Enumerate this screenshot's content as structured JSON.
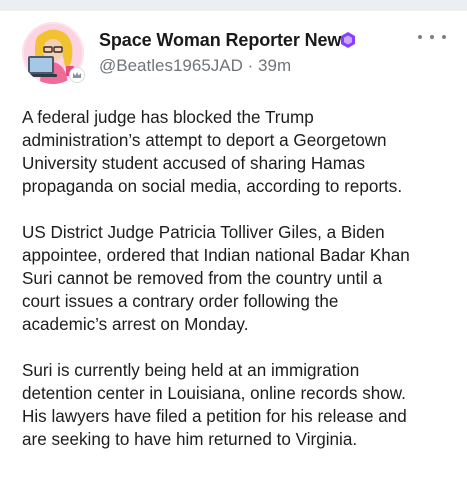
{
  "post": {
    "author": {
      "name": "Space Woman Reporter News",
      "handle": "@Beatles1965JAD",
      "separator": "·",
      "time": "39m",
      "avatar": "avatar-illustration-woman-with-laptop",
      "verified_icon": "hexagon-badge-icon",
      "avatar_badge_icon": "crown-icon"
    },
    "more_icon": "more-horizontal-icon",
    "paragraphs": [
      {
        "lines": [
          "A federal judge has blocked the Trump",
          "administration’s attempt to deport a Georgetown",
          "University student accused of sharing Hamas",
          "propaganda on social media, according to reports."
        ]
      },
      {
        "lines": [
          "US District Judge Patricia Tolliver Giles, a Biden",
          "appointee, ordered that Indian national Badar Khan",
          "Suri cannot be removed from the country until a",
          "court issues a contrary order following the",
          "academic’s arrest on Monday."
        ]
      },
      {
        "lines": [
          "Suri is currently being held at an immigration",
          "detention center in Louisiana, online records show.",
          "His lawyers have filed a petition for his release and",
          "are seeking to have him returned to Virginia."
        ]
      }
    ]
  },
  "colors": {
    "verified_badge": "#8a3ffc",
    "text": "#1d1d1f",
    "secondary_text": "#707579",
    "top_strip": "#eceff1"
  }
}
